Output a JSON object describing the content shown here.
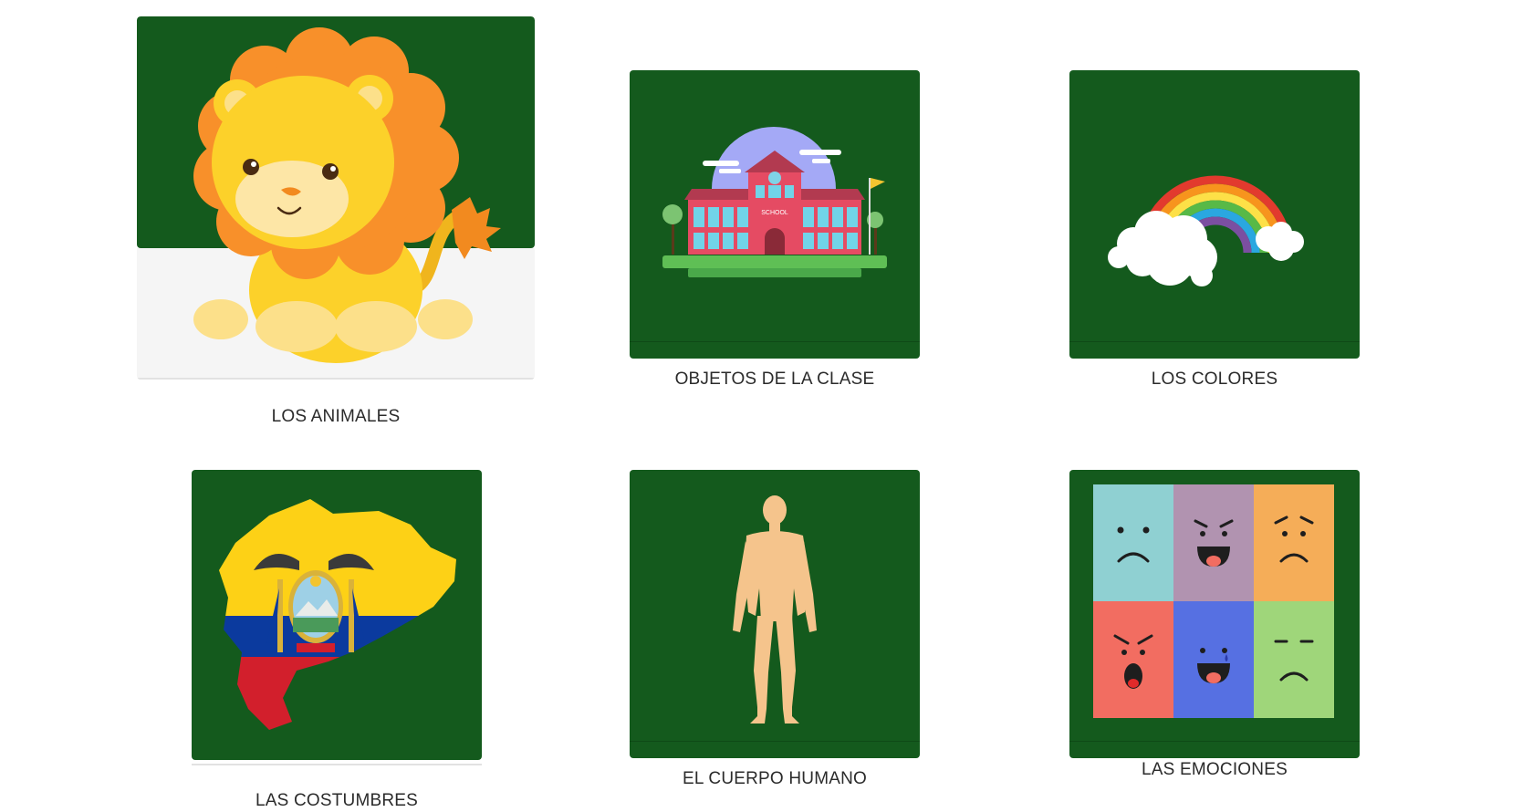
{
  "cards": [
    {
      "label": "LOS ANIMALES",
      "image": "lion-illustration"
    },
    {
      "label": "OBJETOS DE LA CLASE",
      "image": "school-building-illustration",
      "sign": "SCHOOL"
    },
    {
      "label": "LOS COLORES",
      "image": "rainbow-illustration"
    },
    {
      "label": "LAS COSTUMBRES",
      "image": "ecuador-flag-map-illustration"
    },
    {
      "label": "EL CUERPO HUMANO",
      "image": "human-body-illustration"
    },
    {
      "label": "LAS EMOCIONES",
      "image": "emotion-faces-grid"
    }
  ],
  "colors": {
    "tile_green": "#145a1d",
    "lion_mane": "#f8902a",
    "lion_body": "#fdd22e",
    "skin": "#f5c48c"
  }
}
